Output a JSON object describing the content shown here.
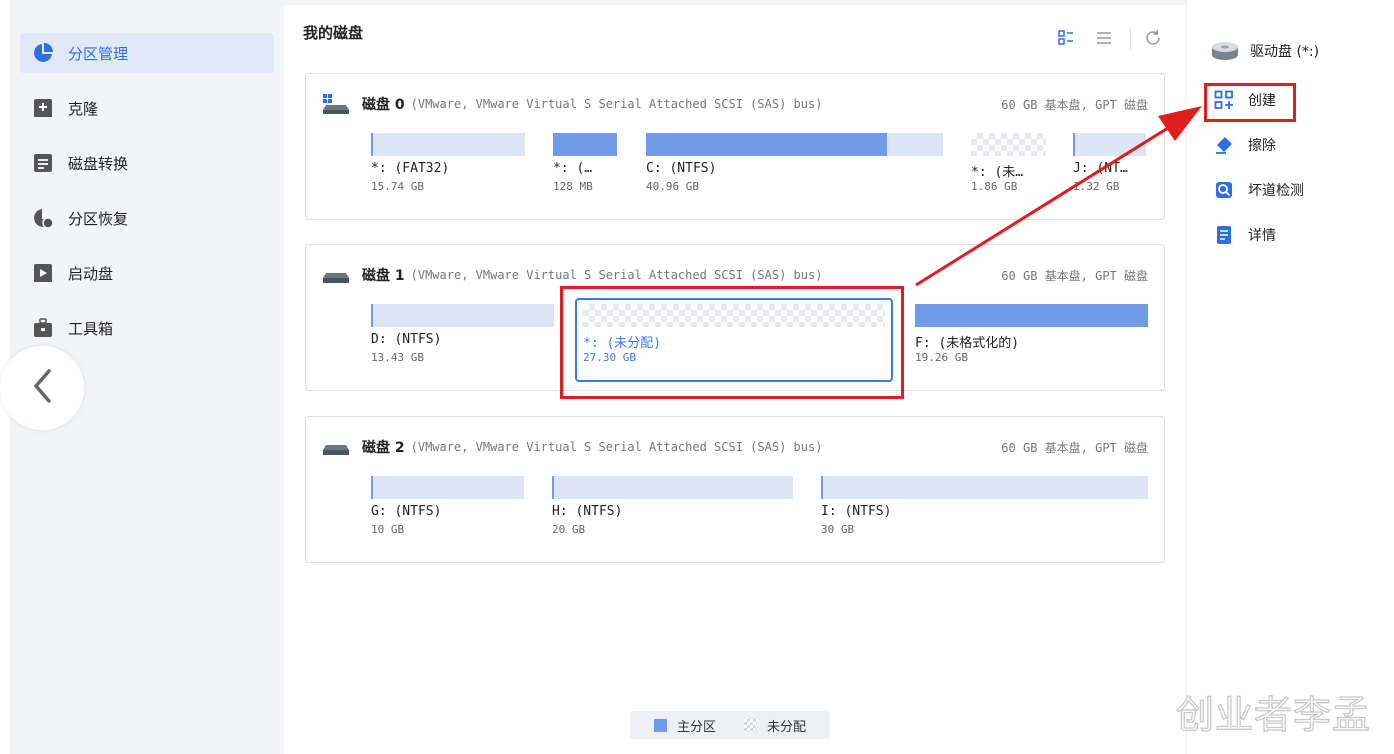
{
  "sidebar": {
    "items": [
      {
        "label": "分区管理",
        "icon": "pie-chart-icon",
        "active": true
      },
      {
        "label": "克隆",
        "icon": "clone-icon",
        "active": false
      },
      {
        "label": "磁盘转换",
        "icon": "disk-convert-icon",
        "active": false
      },
      {
        "label": "分区恢复",
        "icon": "partition-recovery-icon",
        "active": false
      },
      {
        "label": "启动盘",
        "icon": "boot-disk-icon",
        "active": false
      },
      {
        "label": "工具箱",
        "icon": "toolbox-icon",
        "active": false
      }
    ],
    "collapse_icon": "chevron-left-icon"
  },
  "main": {
    "title": "我的磁盘",
    "view_tools": [
      "grid-view-icon",
      "list-view-icon",
      "refresh-icon"
    ],
    "disks": [
      {
        "name": "磁盘 0",
        "desc": "(VMware,  VMware Virtual S Serial Attached SCSI (SAS) bus)",
        "info": "60 GB 基本盘, GPT 磁盘",
        "partitions": [
          {
            "name": "*: (FAT32)",
            "size": "15.74 GB",
            "type": "primary",
            "fill": 0
          },
          {
            "name": "*: (…",
            "size": "128 MB",
            "type": "primary",
            "fill": 1
          },
          {
            "name": "C: (NTFS)",
            "size": "40.96 GB",
            "type": "primary",
            "fill": 0.81
          },
          {
            "name": "*: (未…",
            "size": "1.86 GB",
            "type": "unallocated",
            "fill": 0
          },
          {
            "name": "J: (NT…",
            "size": "1.32 GB",
            "type": "primary",
            "fill": 0
          }
        ]
      },
      {
        "name": "磁盘 1",
        "desc": "(VMware,  VMware Virtual S Serial Attached SCSI (SAS) bus)",
        "info": "60 GB 基本盘, GPT 磁盘",
        "partitions": [
          {
            "name": "D: (NTFS)",
            "size": "13.43 GB",
            "type": "primary",
            "fill": 0
          },
          {
            "name": "*: (未分配)",
            "size": "27.30 GB",
            "type": "unallocated",
            "fill": 0,
            "selected": true
          },
          {
            "name": "F: (未格式化的)",
            "size": "19.26 GB",
            "type": "primary",
            "fill": 1
          }
        ]
      },
      {
        "name": "磁盘 2",
        "desc": "(VMware,  VMware Virtual S Serial Attached SCSI (SAS) bus)",
        "info": "60 GB 基本盘, GPT 磁盘",
        "partitions": [
          {
            "name": "G: (NTFS)",
            "size": "10 GB",
            "type": "primary",
            "fill": 0
          },
          {
            "name": "H: (NTFS)",
            "size": "20 GB",
            "type": "primary",
            "fill": 0
          },
          {
            "name": "I: (NTFS)",
            "size": "30 GB",
            "type": "primary",
            "fill": 0
          }
        ]
      }
    ]
  },
  "right_panel": {
    "drive": "驱动盘 (*:)",
    "actions": [
      {
        "label": "创建",
        "icon": "create-partition-icon"
      },
      {
        "label": "擦除",
        "icon": "eraser-icon"
      },
      {
        "label": "坏道检测",
        "icon": "surface-test-icon"
      },
      {
        "label": "详情",
        "icon": "details-icon"
      }
    ]
  },
  "legend": {
    "primary": "主分区",
    "unallocated": "未分配"
  },
  "watermark": "创业者李孟",
  "colors": {
    "accent": "#2d6fe0",
    "primary_fill": "#6f9be9",
    "bar_bg": "#dde5f4",
    "highlight_red": "#e01e1e"
  }
}
